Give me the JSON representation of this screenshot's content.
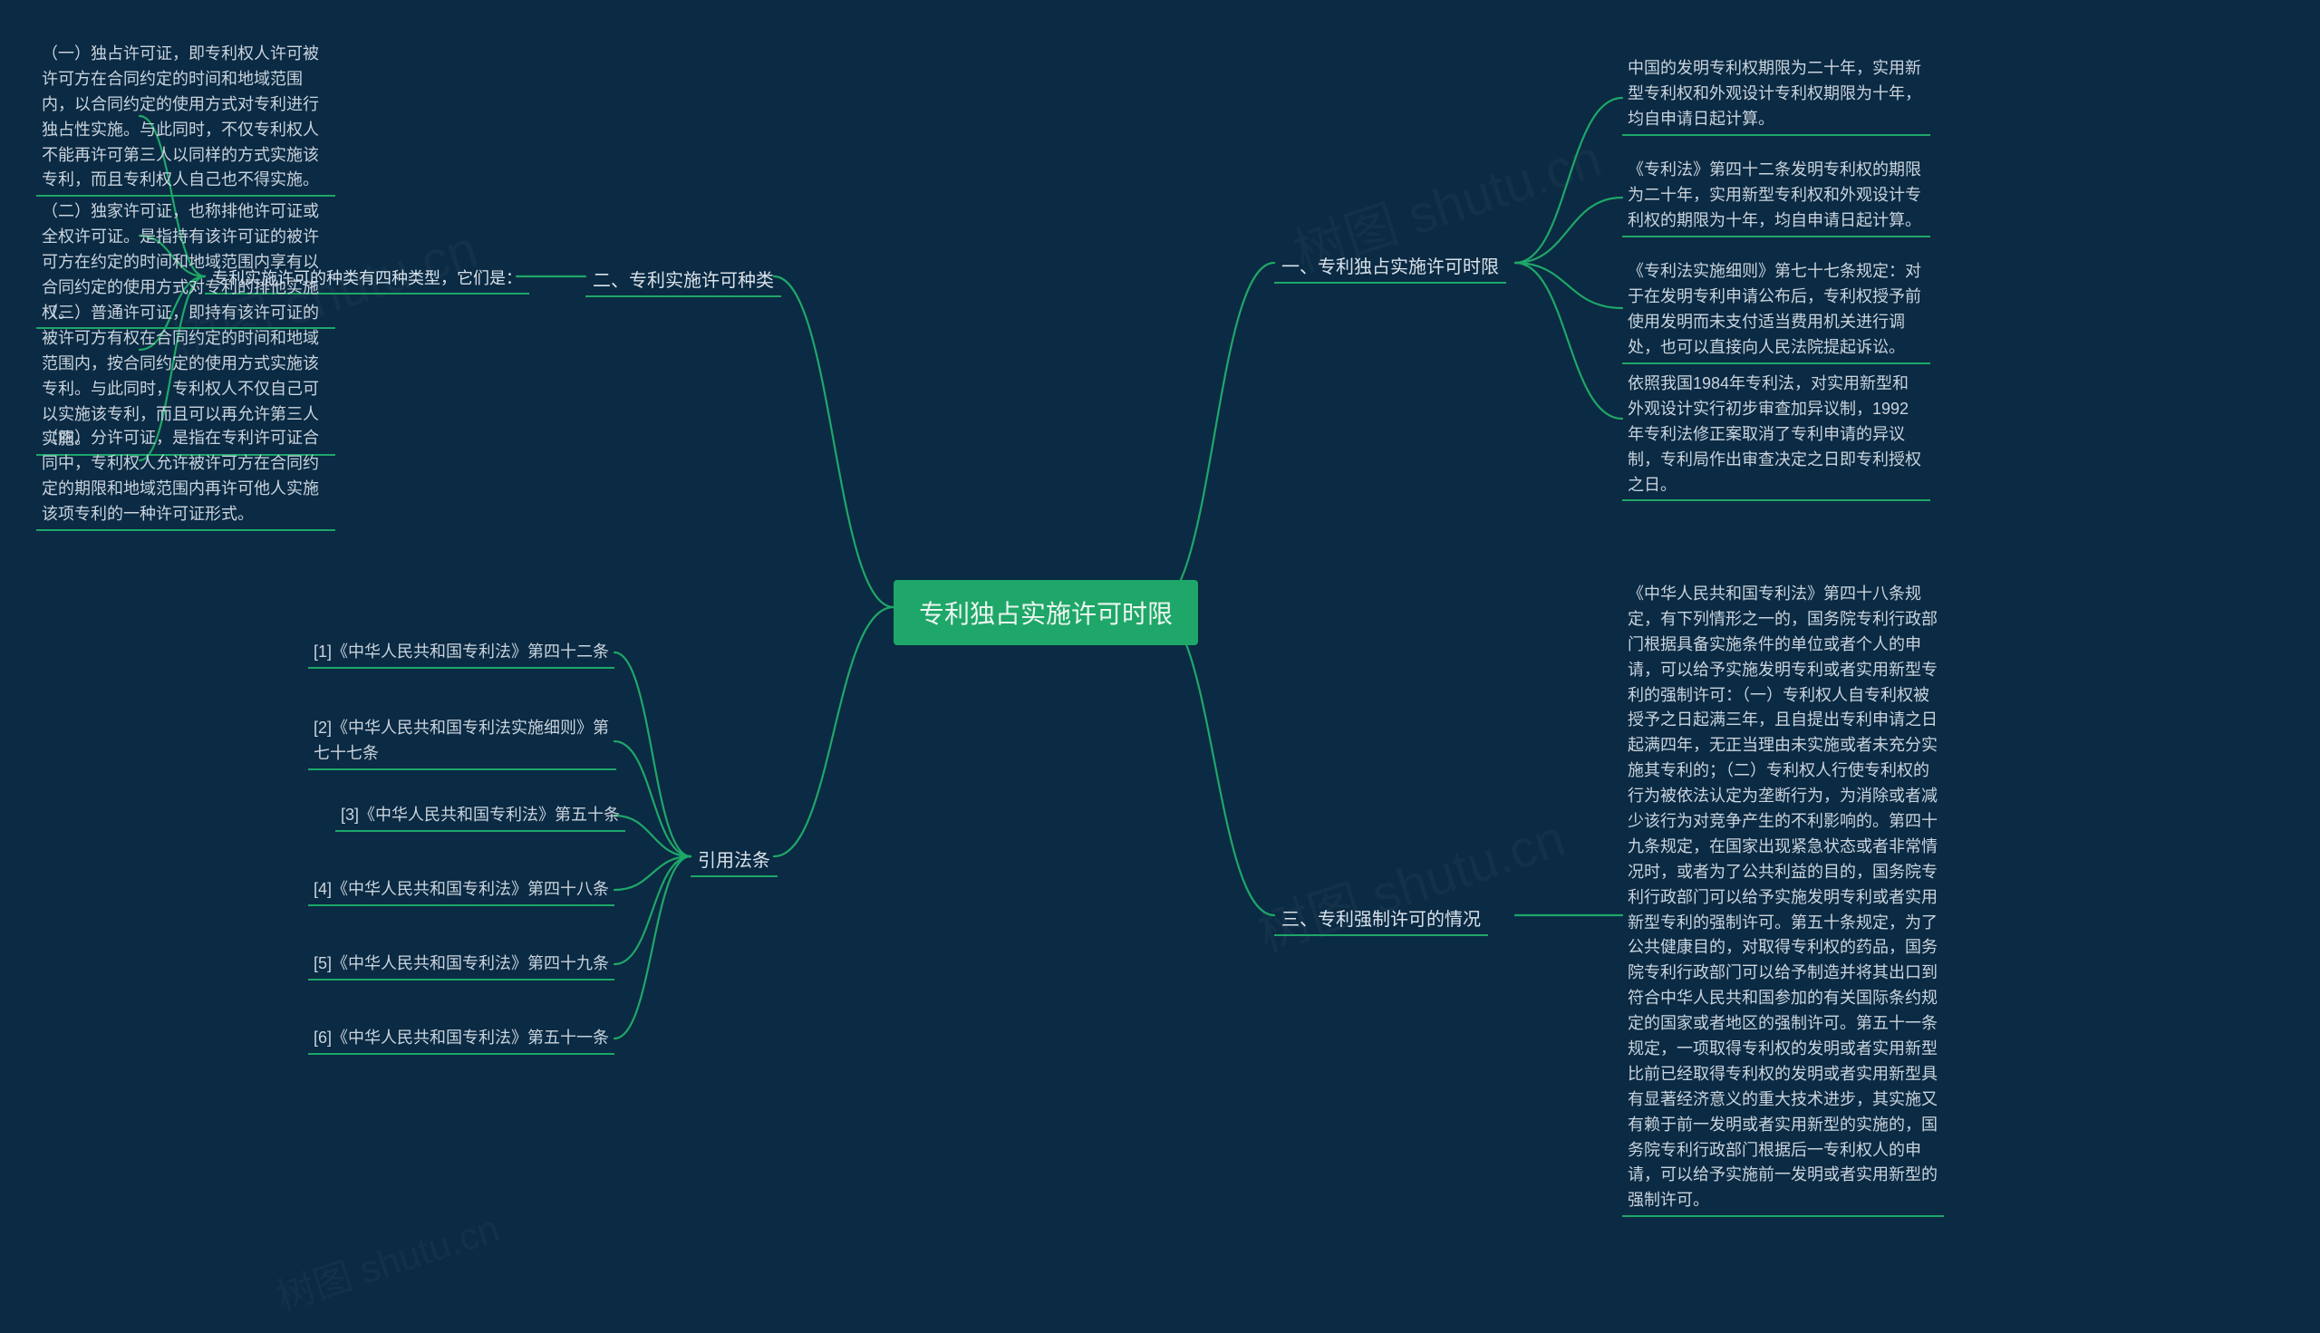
{
  "center": {
    "title": "专利独占实施许可时限"
  },
  "right": {
    "branch1": {
      "label": "一、专利独占实施许可时限",
      "leaves": [
        "中国的发明专利权期限为二十年，实用新型专利权和外观设计专利权期限为十年，均自申请日起计算。",
        "《专利法》第四十二条发明专利权的期限为二十年，实用新型专利权和外观设计专利权的期限为十年，均自申请日起计算。",
        "《专利法实施细则》第七十七条规定：对于在发明专利申请公布后，专利权授予前使用发明而未支付适当费用机关进行调处，也可以直接向人民法院提起诉讼。",
        "依照我国1984年专利法，对实用新型和外观设计实行初步审查加异议制，1992年专利法修正案取消了专利申请的异议制，专利局作出审查决定之日即专利授权之日。"
      ]
    },
    "branch3": {
      "label": "三、专利强制许可的情况",
      "leaf": "《中华人民共和国专利法》第四十八条规定，有下列情形之一的，国务院专利行政部门根据具备实施条件的单位或者个人的申请，可以给予实施发明专利或者实用新型专利的强制许可：（一）专利权人自专利权被授予之日起满三年，且自提出专利申请之日起满四年，无正当理由未实施或者未充分实施其专利的；（二）专利权人行使专利权的行为被依法认定为垄断行为，为消除或者减少该行为对竞争产生的不利影响的。第四十九条规定，在国家出现紧急状态或者非常情况时，或者为了公共利益的目的，国务院专利行政部门可以给予实施发明专利或者实用新型专利的强制许可。第五十条规定，为了公共健康目的，对取得专利权的药品，国务院专利行政部门可以给予制造并将其出口到符合中华人民共和国参加的有关国际条约规定的国家或者地区的强制许可。第五十一条规定，一项取得专利权的发明或者实用新型比前已经取得专利权的发明或者实用新型具有显著经济意义的重大技术进步，其实施又有赖于前一发明或者实用新型的实施的，国务院专利行政部门根据后一专利权人的申请，可以给予实施前一发明或者实用新型的强制许可。"
    }
  },
  "left": {
    "branch2": {
      "label": "二、专利实施许可种类",
      "bridge": "专利实施许可的种类有四种类型，它们是：",
      "leaves": [
        "（一）独占许可证，即专利权人许可被许可方在合同约定的时间和地域范围内，以合同约定的使用方式对专利进行独占性实施。与此同时，不仅专利权人不能再许可第三人以同样的方式实施该专利，而且专利权人自己也不得实施。",
        "（二）独家许可证，也称排他许可证或全权许可证。是指持有该许可证的被许可方在约定的时间和地域范围内享有以合同约定的使用方式对专利的排他实施权。",
        "（三）普通许可证，即持有该许可证的被许可方有权在合同约定的时间和地域范围内，按合同约定的使用方式实施该专利。与此同时，专利权人不仅自己可以实施该专利，而且可以再允许第三人实施。",
        "（四）分许可证，是指在专利许可证合同中，专利权人允许被许可方在合同约定的期限和地域范围内再许可他人实施该项专利的一种许可证形式。"
      ]
    },
    "branch4": {
      "label": "引用法条",
      "leaves": [
        "[1]《中华人民共和国专利法》第四十二条",
        "[2]《中华人民共和国专利法实施细则》第七十七条",
        "[3]《中华人民共和国专利法》第五十条",
        "[4]《中华人民共和国专利法》第四十八条",
        "[5]《中华人民共和国专利法》第四十九条",
        "[6]《中华人民共和国专利法》第五十一条"
      ]
    }
  },
  "watermark": "树图 shutu.cn"
}
